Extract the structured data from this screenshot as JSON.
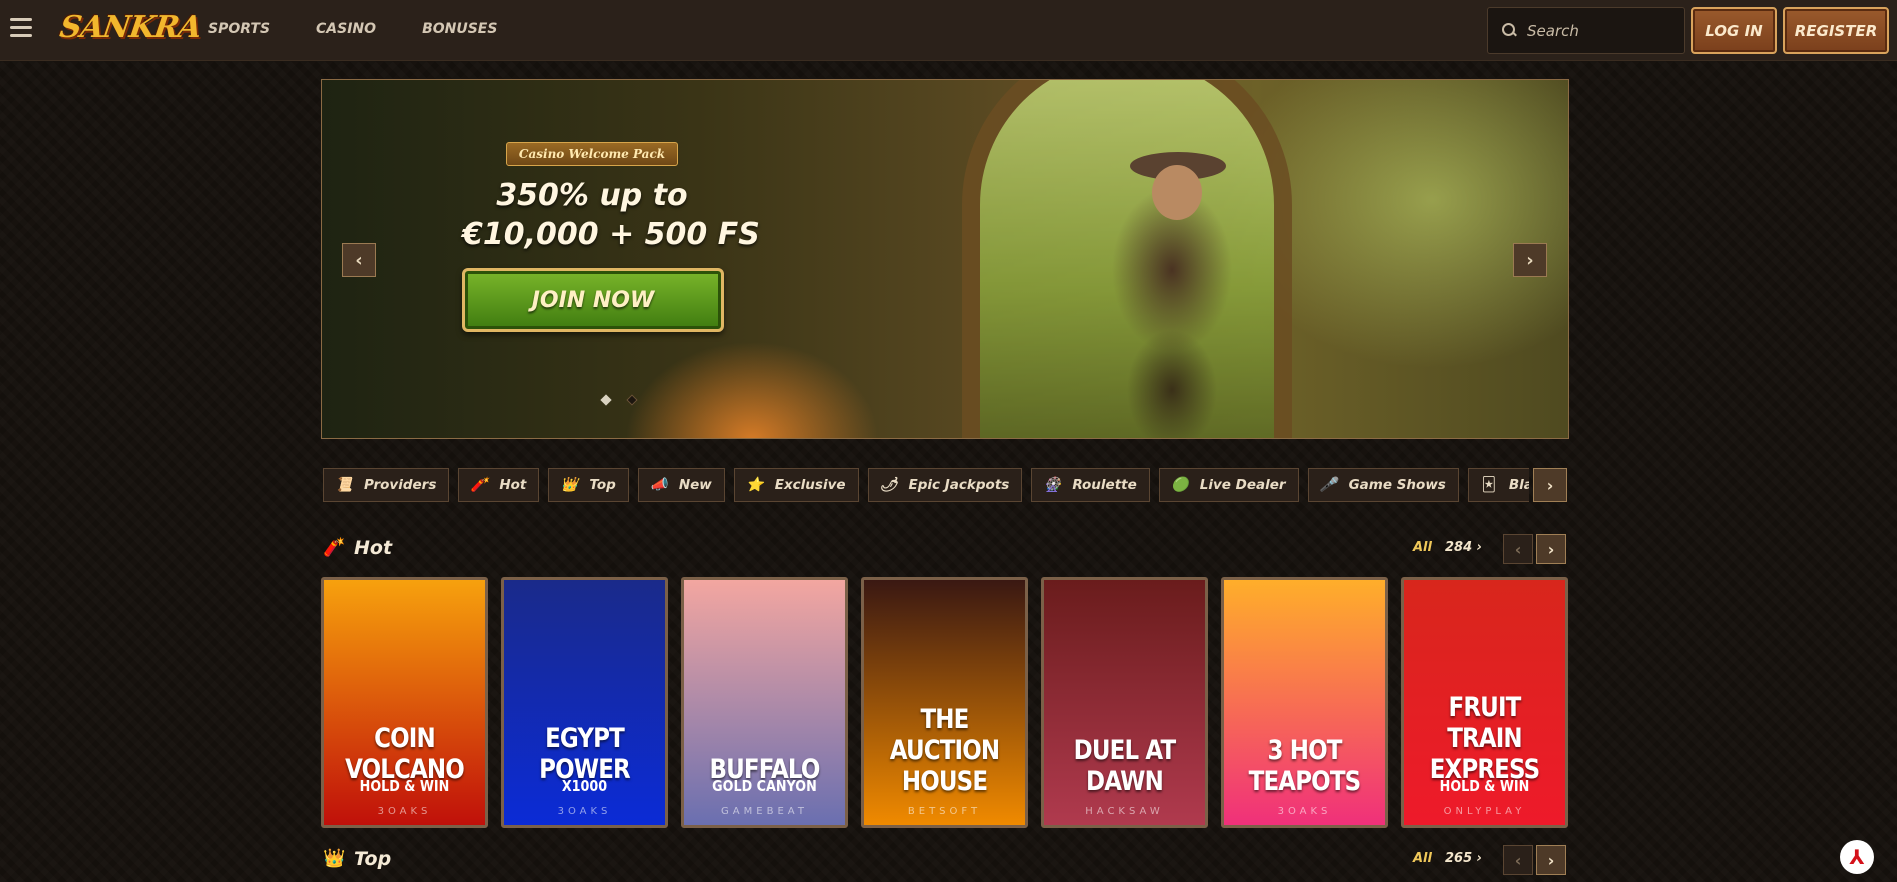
{
  "header": {
    "logo": "SANKRA",
    "nav": [
      "SPORTS",
      "CASINO",
      "BONUSES"
    ],
    "search_placeholder": "Search",
    "login_label": "LOG IN",
    "register_label": "REGISTER"
  },
  "hero": {
    "badge": "Casino Welcome Pack",
    "title_line1": "350% up to",
    "title_line2": "€10,000 + 500 FS",
    "cta": "JOIN NOW",
    "prev_icon": "‹",
    "next_icon": "›"
  },
  "categories": [
    {
      "label": "Providers",
      "icon": "📜"
    },
    {
      "label": "Hot",
      "icon": "🧨"
    },
    {
      "label": "Top",
      "icon": "👑"
    },
    {
      "label": "New",
      "icon": "📣"
    },
    {
      "label": "Exclusive",
      "icon": "⭐"
    },
    {
      "label": "Epic Jackpots",
      "icon": "🌶"
    },
    {
      "label": "Roulette",
      "icon": "🎡"
    },
    {
      "label": "Live Dealer",
      "icon": "🟢"
    },
    {
      "label": "Game Shows",
      "icon": "🎤"
    },
    {
      "label": "Blackjack",
      "icon": "🃏"
    }
  ],
  "sections": {
    "hot": {
      "title": "Hot",
      "all": "All",
      "count": "284 ›",
      "icon": "🧨"
    },
    "top": {
      "title": "Top",
      "all": "All",
      "count": "265 ›",
      "icon": "👑"
    }
  },
  "games": [
    {
      "name": "COIN VOLCANO",
      "sub": "HOLD & WIN",
      "provider": "3OAKS",
      "c1": "#f7a10d",
      "c2": "#c0100a"
    },
    {
      "name": "EGYPT POWER",
      "sub": "X1000",
      "provider": "3OAKS",
      "c1": "#1a2a8a",
      "c2": "#0b2bd6"
    },
    {
      "name": "BUFFALO",
      "sub": "GOLD CANYON",
      "provider": "GAMEBEAT",
      "c1": "#f3a6a0",
      "c2": "#6a6fb0"
    },
    {
      "name": "THE AUCTION HOUSE",
      "sub": "",
      "provider": "BETSOFT",
      "c1": "#3a1812",
      "c2": "#f08a00"
    },
    {
      "name": "DUEL AT DAWN",
      "sub": "",
      "provider": "HACKSAW",
      "c1": "#6a1c1c",
      "c2": "#b03a4e"
    },
    {
      "name": "3 HOT TEAPOTS",
      "sub": "",
      "provider": "3OAKS",
      "c1": "#ffae2a",
      "c2": "#f0307a"
    },
    {
      "name": "FRUIT TRAIN EXPRESS",
      "sub": "HOLD & WIN",
      "provider": "ONLYPLAY",
      "c1": "#d8261c",
      "c2": "#ee1a2a"
    }
  ]
}
